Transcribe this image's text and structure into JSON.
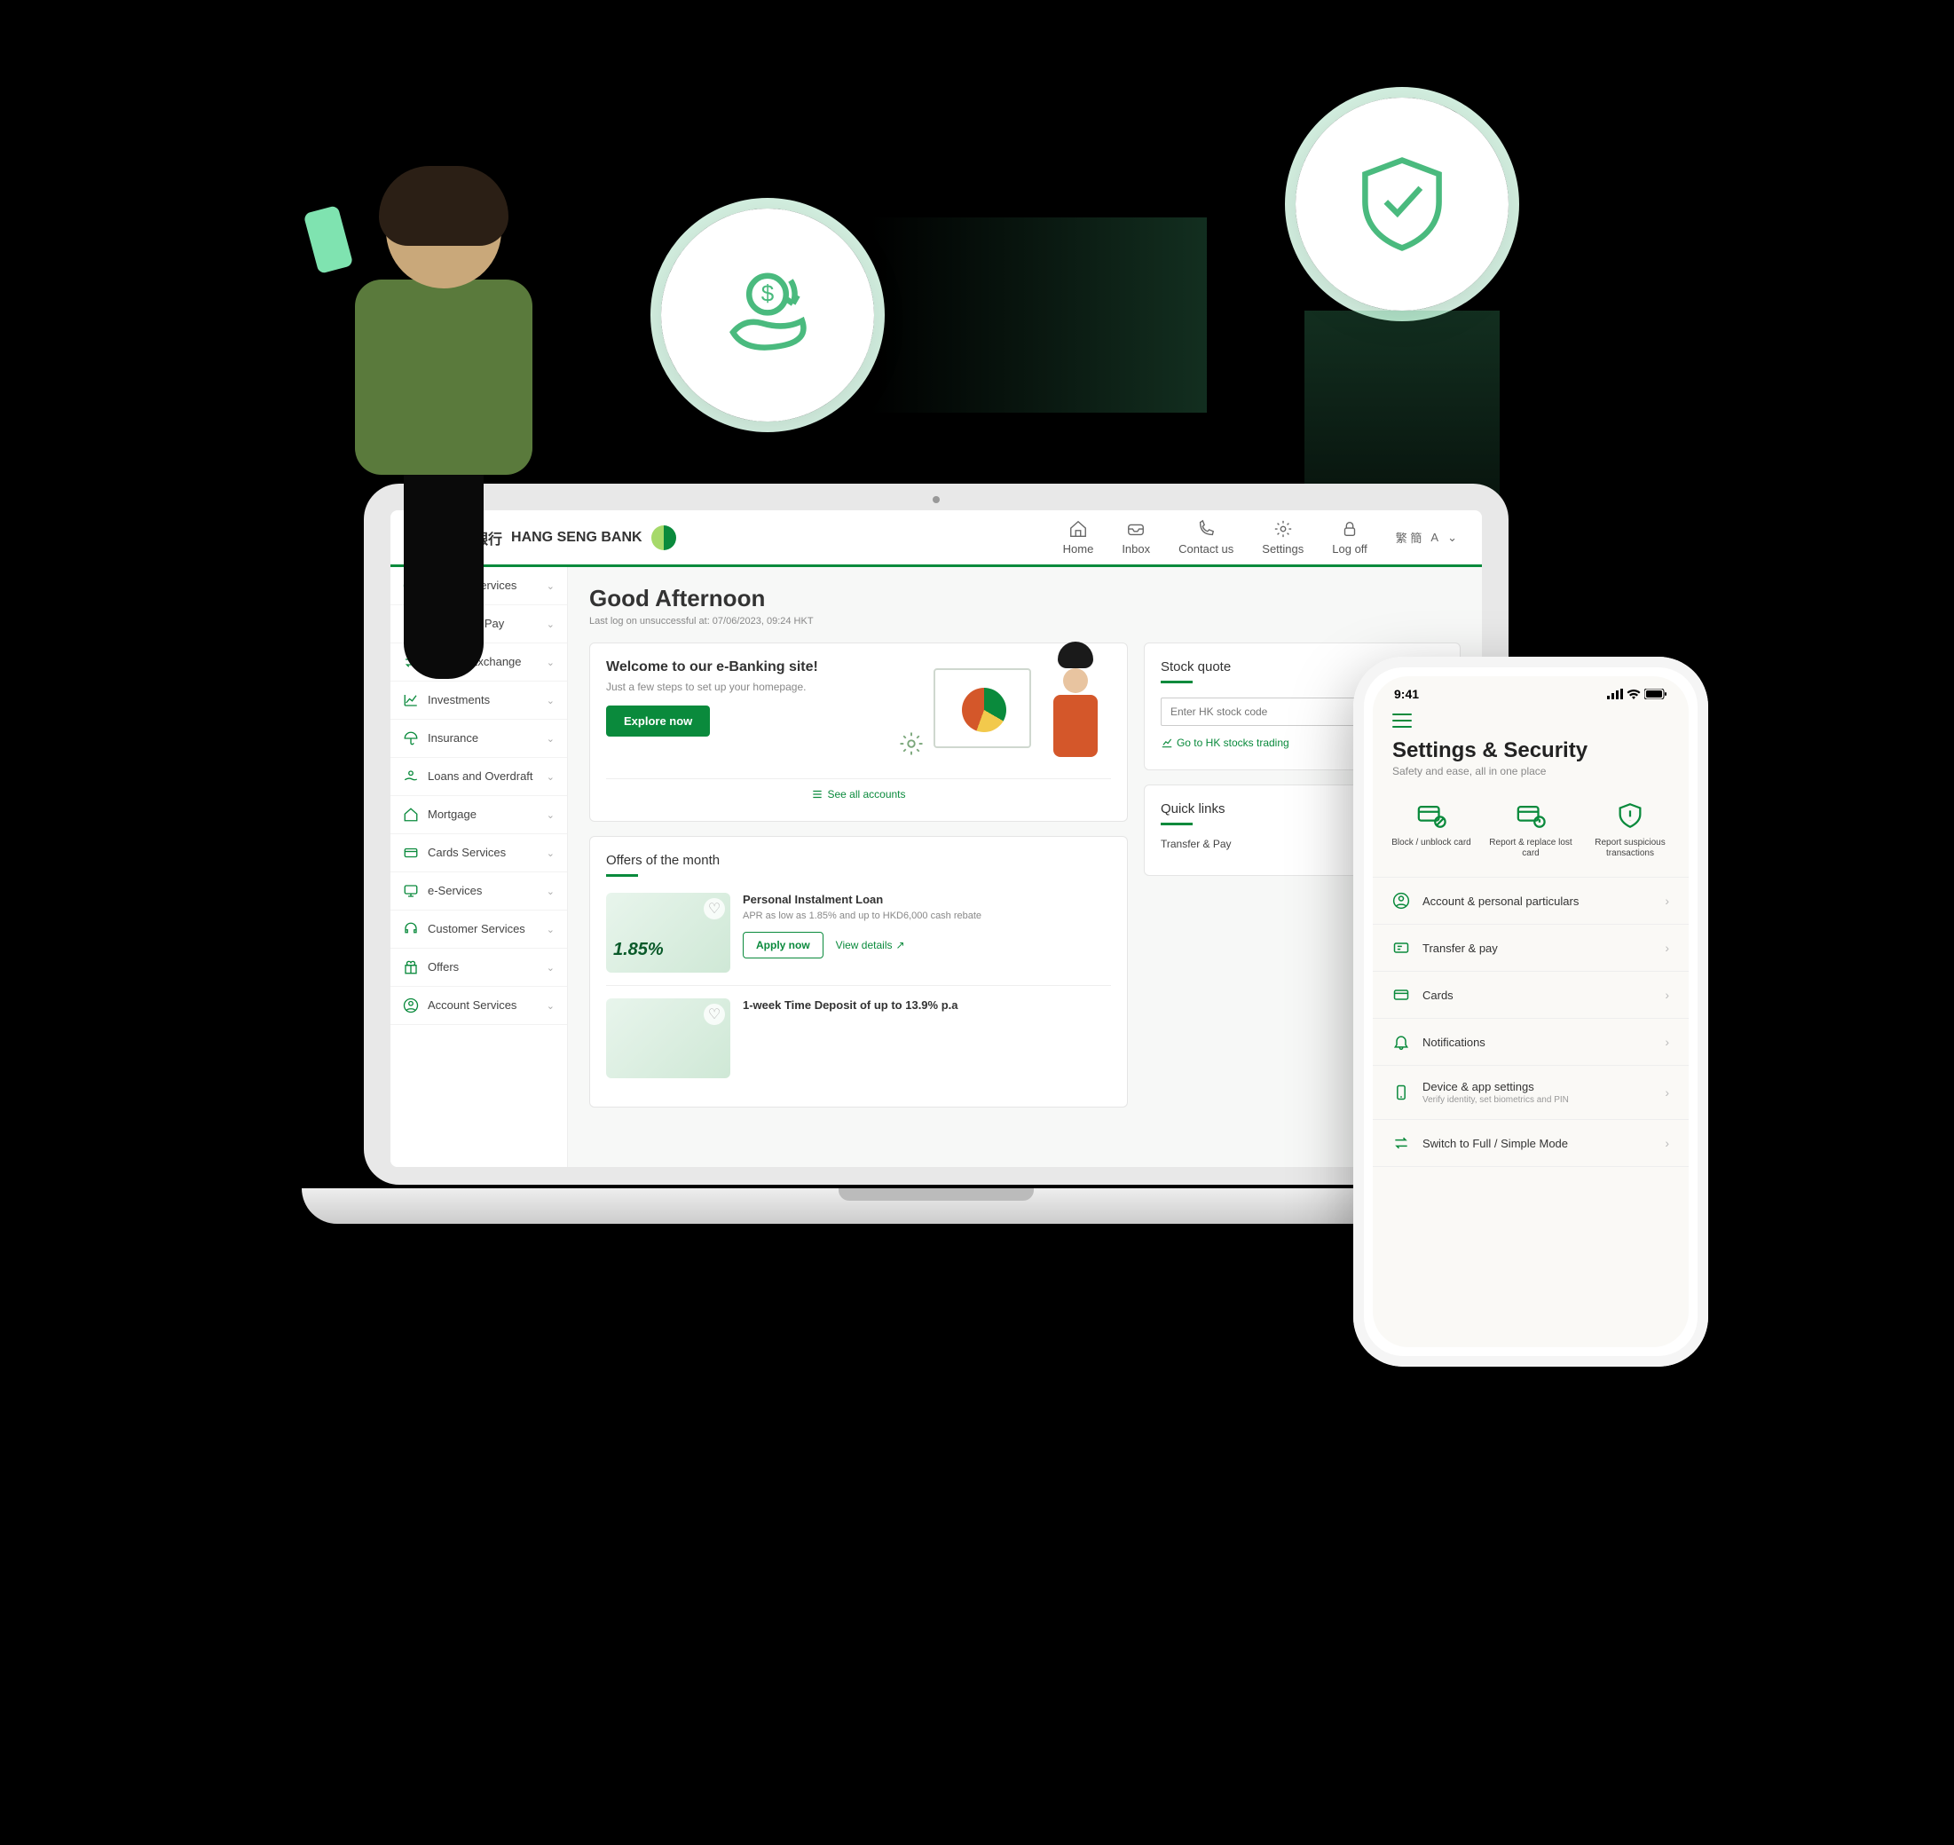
{
  "brand": {
    "cn": "恒生銀行",
    "en": "HANG SENG BANK"
  },
  "topnav": {
    "home": "Home",
    "inbox": "Inbox",
    "contact": "Contact us",
    "settings": "Settings",
    "logoff": "Log off"
  },
  "sidebar": {
    "items": [
      {
        "icon": "person-circle",
        "label": "Account Services"
      },
      {
        "icon": "card-arrows",
        "label": "Transfer & Pay"
      },
      {
        "icon": "exchange",
        "label": "Foreign Exchange"
      },
      {
        "icon": "chart-line",
        "label": "Investments"
      },
      {
        "icon": "umbrella",
        "label": "Insurance"
      },
      {
        "icon": "hand-coin",
        "label": "Loans and Overdraft"
      },
      {
        "icon": "house",
        "label": "Mortgage"
      },
      {
        "icon": "credit-card",
        "label": "Cards Services"
      },
      {
        "icon": "monitor",
        "label": "e-Services"
      },
      {
        "icon": "headset",
        "label": "Customer Services"
      },
      {
        "icon": "gift",
        "label": "Offers"
      },
      {
        "icon": "person-circle",
        "label": "Account Services"
      }
    ]
  },
  "greeting": "Good Afternoon",
  "lastlog": "Last log on unsuccessful at: 07/06/2023, 09:24 HKT",
  "welcome": {
    "title": "Welcome to our e-Banking site!",
    "subtitle": "Just a few steps to set up your homepage.",
    "button": "Explore now",
    "see_all": "See all accounts"
  },
  "offers": {
    "title": "Offers of the month",
    "items": [
      {
        "rate": "1.85%",
        "title": "Personal Instalment Loan",
        "desc": "APR as low as 1.85% and up to HKD6,000 cash rebate",
        "apply": "Apply now",
        "view": "View details"
      },
      {
        "title": "1-week Time Deposit of up to 13.9% p.a"
      }
    ]
  },
  "stock": {
    "title": "Stock quote",
    "placeholder": "Enter HK stock code",
    "link": "Go to HK stocks trading"
  },
  "quick": {
    "title": "Quick links",
    "item1": "Transfer & Pay"
  },
  "topright": {
    "lang": "繁 簡",
    "font": "A"
  },
  "phone": {
    "time": "9:41",
    "title": "Settings & Security",
    "subtitle": "Safety and ease, all in one place",
    "actions": [
      {
        "label": "Block / unblock card"
      },
      {
        "label": "Report & replace lost card"
      },
      {
        "label": "Report suspicious transactions"
      }
    ],
    "rows": [
      {
        "icon": "person-circle",
        "label": "Account & personal particulars"
      },
      {
        "icon": "card-arrows",
        "label": "Transfer & pay"
      },
      {
        "icon": "credit-card",
        "label": "Cards"
      },
      {
        "icon": "bell",
        "label": "Notifications"
      },
      {
        "icon": "device",
        "label": "Device & app settings",
        "sub": "Verify identity, set biometrics and PIN"
      },
      {
        "icon": "switch",
        "label": "Switch to Full / Simple Mode"
      }
    ]
  }
}
